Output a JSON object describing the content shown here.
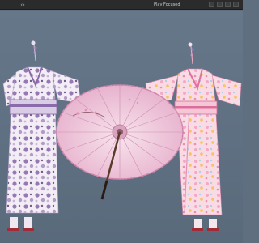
{
  "toolbar": {
    "play_status": "Play Focused",
    "left_icon": "chevron-icon"
  },
  "scene": {
    "objects": [
      {
        "name": "kimono-purple-floral",
        "icon": "kimono-model"
      },
      {
        "name": "parasol",
        "icon": "wagasa-umbrella-model"
      },
      {
        "name": "kimono-pink-floral",
        "icon": "kimono-model"
      }
    ]
  },
  "colors": {
    "background": "#5f6f80",
    "toolbar": "#2b2b2b",
    "kimono_left_base": "#f4eef6",
    "kimono_left_floral": "#8a6aa8",
    "kimono_right_base": "#f6d9e2",
    "kimono_right_trim": "#e890b4",
    "parasol": "#f2cfe0"
  }
}
